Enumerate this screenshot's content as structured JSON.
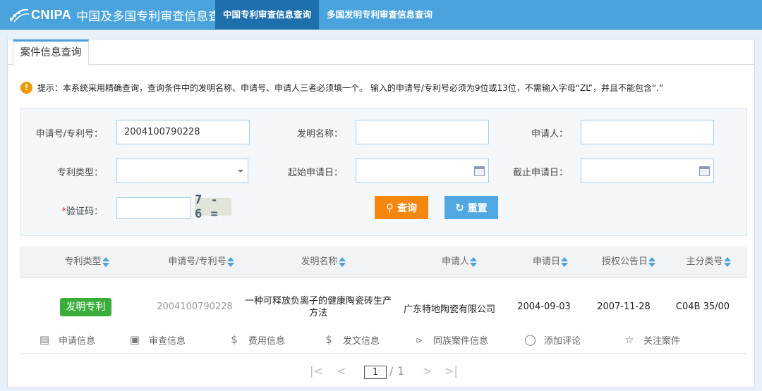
{
  "header": {
    "brand": "CNIPA",
    "site_title": "中国及多国专利审查信息查询",
    "nav": [
      "中国专利审查信息查询",
      "多国发明专利审查信息查询"
    ]
  },
  "tab": {
    "label": "案件信息查询"
  },
  "notice": "提示：本系统采用精确查询，查询条件中的发明名称、申请号、申请人三者必须填一个。 输入的申请号/专利号必须为9位或13位，不需输入字母“ZL”，并且不能包含“.”",
  "form": {
    "app_no_label": "申请号/专利号：",
    "app_no_value": "2004100790228",
    "invention_name_label": "发明名称：",
    "invention_name_value": "",
    "applicant_label": "申请人：",
    "applicant_value": "",
    "patent_type_label": "专利类型：",
    "patent_type_value": "",
    "start_date_label": "起始申请日：",
    "start_date_value": "",
    "end_date_label": "截止申请日：",
    "end_date_value": "",
    "captcha_required_mark": "*",
    "captcha_label": "验证码：",
    "captcha_value": "",
    "captcha_image_text": "7 - 6 =",
    "search_button": "查询",
    "reset_button": "重置"
  },
  "table": {
    "headers": [
      "专利类型",
      "申请号/专利号",
      "发明名称",
      "申请人",
      "申请日",
      "授权公告日",
      "主分类号"
    ],
    "rows": [
      {
        "type": "发明专利",
        "app_no": "2004100790228",
        "name": "一种可释放负离子的健康陶瓷砖生产方法",
        "applicant": "广东特地陶瓷有限公司",
        "app_date": "2004-09-03",
        "grant_date": "2007-11-28",
        "class": "C04B 35/00"
      }
    ],
    "actions": [
      "申请信息",
      "审查信息",
      "费用信息",
      "发文信息",
      "同族案件信息",
      "添加评论",
      "关注案件"
    ]
  },
  "pagination": {
    "first": "|<",
    "prev": "<",
    "current": "1",
    "separator": "/",
    "total": "1",
    "next": ">",
    "last": ">|"
  },
  "colors": {
    "header_bg": "#4aa3dc",
    "active_nav_bg": "#1d6fae",
    "search_button": "#f5870f",
    "reset_button": "#4fa8e2",
    "type_badge": "#3aae3a"
  }
}
